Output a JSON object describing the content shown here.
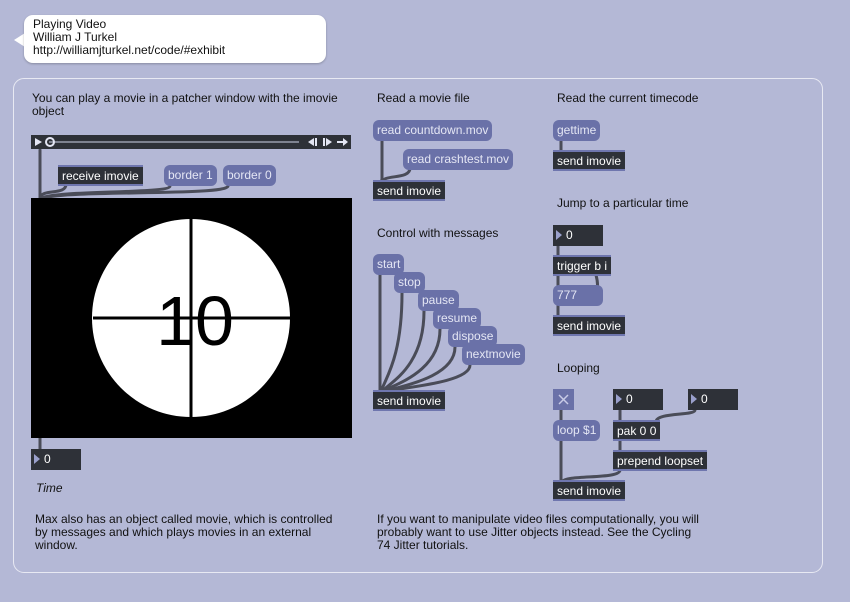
{
  "header_bubble": {
    "title": "Playing Video",
    "author": "William J Turkel",
    "url": "http://williamjturkel.net/code/#exhibit"
  },
  "comments": {
    "intro": "You can play a movie in a patcher window with the imovie object",
    "read_file": "Read a movie file",
    "control": "Control with messages",
    "read_timecode": "Read the current timecode",
    "jump": "Jump to a particular time",
    "looping": "Looping",
    "time": "Time",
    "movie_note": "Max also has an object called movie, which is controlled by messages and which plays movies in an external window.",
    "jitter_note": "If you want to manipulate video files computationally, you will probably want to use Jitter objects instead. See the Cycling 74 Jitter tutorials."
  },
  "messages": {
    "border_1": "border 1",
    "border_0": "border 0",
    "read_countdown": "read countdown.mov",
    "read_crashtest": "read crashtest.mov",
    "start": "start",
    "stop": "stop",
    "pause": "pause",
    "resume": "resume",
    "dispose": "dispose",
    "nextmovie": "nextmovie",
    "gettime": "gettime",
    "time_777": "777",
    "loop": "loop $1"
  },
  "objects": {
    "receive_imovie": "receive imovie",
    "send_imovie": "send imovie",
    "trigger": "trigger b i",
    "pak": "pak 0 0",
    "prepend": "prepend loopset"
  },
  "numbers": {
    "time_value": "0",
    "jump_value": "0",
    "loop_start": "0",
    "loop_end": "0"
  },
  "movie": {
    "frame_number": "10"
  },
  "icons": {
    "play": "play-icon",
    "step_back": "step-back-icon",
    "step_forward": "step-forward-icon",
    "loop_arrow": "arrow-right-icon",
    "toggle": "toggle-x-icon"
  },
  "colors": {
    "background": "#b4b8d6",
    "message_box": "#6a71a8",
    "object_box": "#2e3138",
    "patch_cord": "#4a4c58"
  }
}
